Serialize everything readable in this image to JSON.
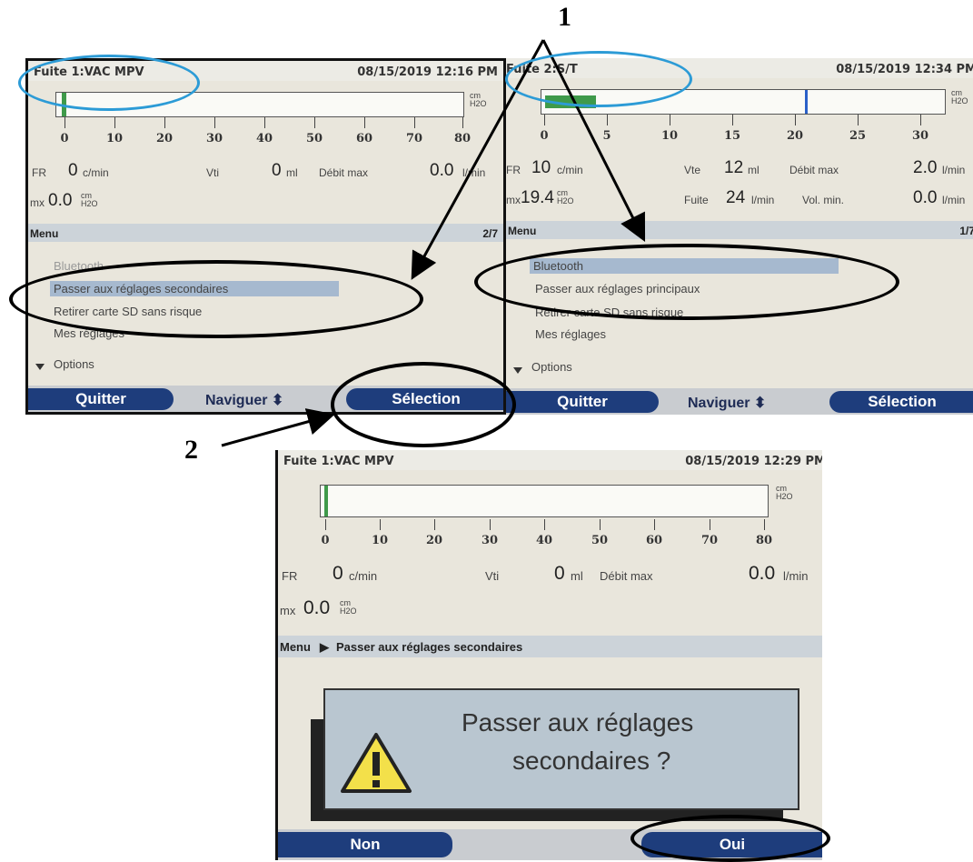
{
  "annotations": {
    "label1": "1",
    "label2": "2"
  },
  "screen1": {
    "title": "Fuite 1:VAC MPV",
    "datetime": "08/15/2019 12:16 PM",
    "gauge_unit_top": "cm",
    "gauge_unit_bottom": "H2O",
    "gauge_ticks": [
      "0",
      "10",
      "20",
      "30",
      "40",
      "50",
      "60",
      "70",
      "80"
    ],
    "fr_label": "FR",
    "fr_value": "0",
    "fr_unit": "c/min",
    "vt_label": "Vti",
    "vt_value": "0",
    "vt_unit": "ml",
    "debit_label": "Débit max",
    "debit_value": "0.0",
    "debit_unit": "l/min",
    "p_label": "mx",
    "p_value": "0.0",
    "p_unit_top": "cm",
    "p_unit_bottom": "H2O",
    "menu_title": "Menu",
    "menu_page": "2/7",
    "menu_items": [
      "Bluetooth",
      "Passer aux réglages secondaires",
      "Retirer carte SD sans risque",
      "Mes réglages",
      "Options"
    ],
    "btn_quit": "Quitter",
    "btn_nav": "Naviguer",
    "btn_select": "Sélection"
  },
  "screen2": {
    "title": "Fuite 2:S/T",
    "datetime": "08/15/2019 12:34 PM",
    "gauge_unit_top": "cm",
    "gauge_unit_bottom": "H2O",
    "gauge_ticks": [
      "0",
      "5",
      "10",
      "15",
      "20",
      "25",
      "30"
    ],
    "fr_label": "FR",
    "fr_value": "10",
    "fr_unit": "c/min",
    "vt_label": "Vte",
    "vt_value": "12",
    "vt_unit": "ml",
    "debit_label": "Débit max",
    "debit_value": "2.0",
    "debit_unit": "l/min",
    "p_label": "mx",
    "p_value": "19.4",
    "p_unit_top": "cm",
    "p_unit_bottom": "H2O",
    "fuite_label": "Fuite",
    "fuite_value": "24",
    "fuite_unit": "l/min",
    "volmin_label": "Vol. min.",
    "volmin_value": "0.0",
    "volmin_unit": "l/min",
    "menu_title": "Menu",
    "menu_page": "1/7",
    "menu_items": [
      "Bluetooth",
      "Passer aux réglages principaux",
      "Retirer carte SD sans risque",
      "Mes réglages",
      "Options"
    ],
    "btn_quit": "Quitter",
    "btn_nav": "Naviguer",
    "btn_select": "Sélection"
  },
  "screen3": {
    "title": "Fuite 1:VAC MPV",
    "datetime": "08/15/2019 12:29 PM",
    "gauge_unit_top": "cm",
    "gauge_unit_bottom": "H2O",
    "gauge_ticks": [
      "0",
      "10",
      "20",
      "30",
      "40",
      "50",
      "60",
      "70",
      "80"
    ],
    "fr_label": "FR",
    "fr_value": "0",
    "fr_unit": "c/min",
    "vt_label": "Vti",
    "vt_value": "0",
    "vt_unit": "ml",
    "debit_label": "Débit max",
    "debit_value": "0.0",
    "debit_unit": "l/min",
    "p_label": "mx",
    "p_value": "0.0",
    "p_unit_top": "cm",
    "p_unit_bottom": "H2O",
    "menu_title": "Menu",
    "breadcrumb": "Passer aux réglages secondaires",
    "dialog_line1": "Passer aux réglages",
    "dialog_line2": "secondaires ?",
    "btn_no": "Non",
    "btn_yes": "Oui"
  }
}
